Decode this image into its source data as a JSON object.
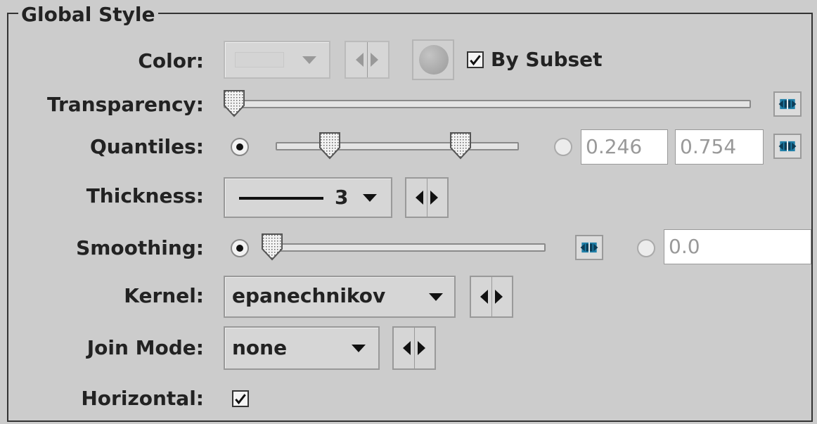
{
  "panel": {
    "title": "Global Style"
  },
  "rows": {
    "color": {
      "label": "Color:",
      "by_subset_label": "By Subset",
      "by_subset_checked": true,
      "enabled": false
    },
    "transparency": {
      "label": "Transparency:",
      "value_fraction": 0.0
    },
    "quantiles": {
      "label": "Quantiles:",
      "low_fraction": 0.25,
      "high_fraction": 0.75,
      "low_value": "0.246",
      "high_value": "0.754",
      "slider_mode_selected": true
    },
    "thickness": {
      "label": "Thickness:",
      "value": "3"
    },
    "smoothing": {
      "label": "Smoothing:",
      "value_fraction": 0.0,
      "value_text": "0.0",
      "slider_mode_selected": true
    },
    "kernel": {
      "label": "Kernel:",
      "value": "epanechnikov"
    },
    "join_mode": {
      "label": "Join Mode:",
      "value": "none"
    },
    "horizontal": {
      "label": "Horizontal:",
      "checked": true
    }
  },
  "icons": {
    "reset": "reset-icon",
    "thumb": "slider-thumb-icon",
    "color_swatch": "color-circle-icon"
  },
  "colors": {
    "background": "#cccccc",
    "reset_accent": "#1f7fa8",
    "disabled_field_text": "#999999"
  }
}
